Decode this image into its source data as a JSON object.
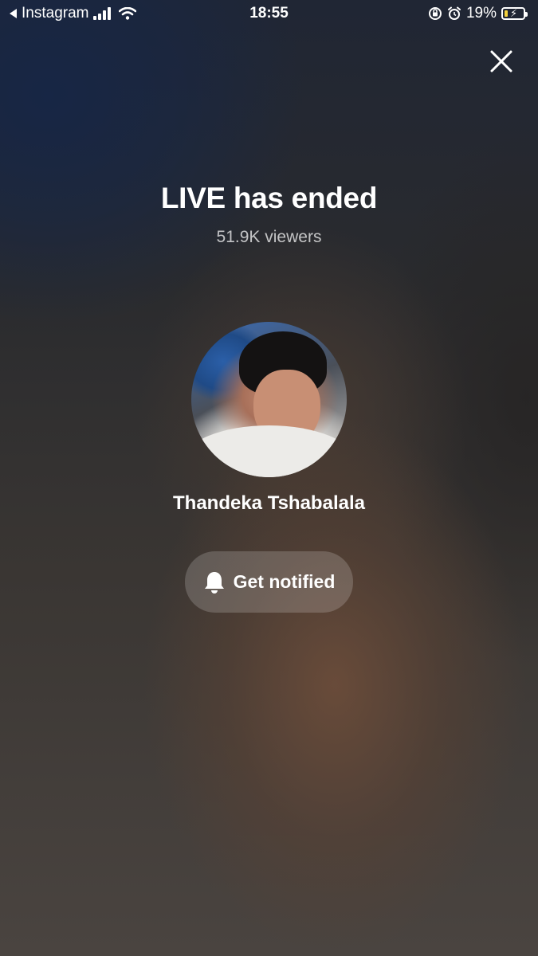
{
  "status_bar": {
    "back_app": "Instagram",
    "time": "18:55",
    "battery_percent": "19%",
    "battery_level": 0.19,
    "battery_color": "#f4d13c"
  },
  "close_icon": "close-icon",
  "live": {
    "title": "LIVE has ended",
    "viewers": "51.9K viewers"
  },
  "profile": {
    "name": "Thandeka Tshabalala"
  },
  "notify_button": {
    "label": "Get notified",
    "icon": "bell-icon"
  }
}
